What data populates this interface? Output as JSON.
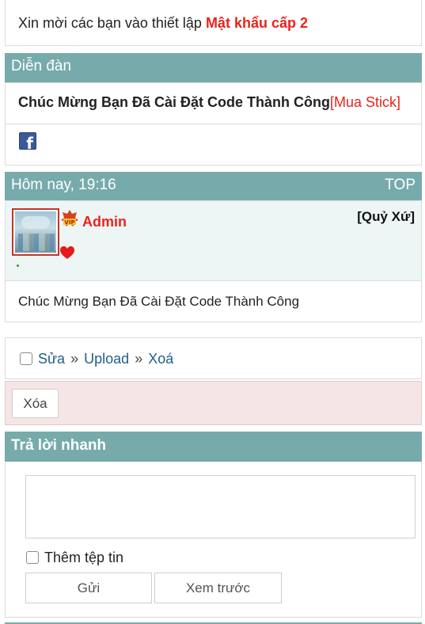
{
  "notice": {
    "text": "Xin mời các bạn vào thiết lập ",
    "link": "Mật khẩu cấp 2"
  },
  "forum": {
    "label": "Diễn đàn",
    "topic_title": "Chúc Mừng Bạn Đã Cài Đặt Code Thành Công",
    "stick_link": "[Mua Stick]"
  },
  "icons": {
    "facebook": "facebook-icon",
    "vip": "vip-badge-icon",
    "heart": "heart-icon"
  },
  "post": {
    "time": "Hôm nay, 19:16",
    "top_link": "TOP",
    "author": "Admin",
    "role": "[Quỷ Xứ]",
    "content": "Chúc Mừng Bạn Đã Cài Đặt Code Thành Công"
  },
  "moderation": {
    "edit": "Sửa",
    "sep1": "»",
    "upload": "Upload",
    "sep2": "»",
    "delete_link": "Xoá",
    "delete_button": "Xóa"
  },
  "quick_reply": {
    "title": "Trả lời nhanh",
    "attach_label": "Thêm tệp tin",
    "send_button": "Gửi",
    "preview_button": "Xem trước"
  },
  "colors": {
    "accent_teal": "#77abab",
    "highlight_red": "#e8231c",
    "link_blue": "#1f5f8b",
    "delete_bg": "#f5e5e6"
  }
}
